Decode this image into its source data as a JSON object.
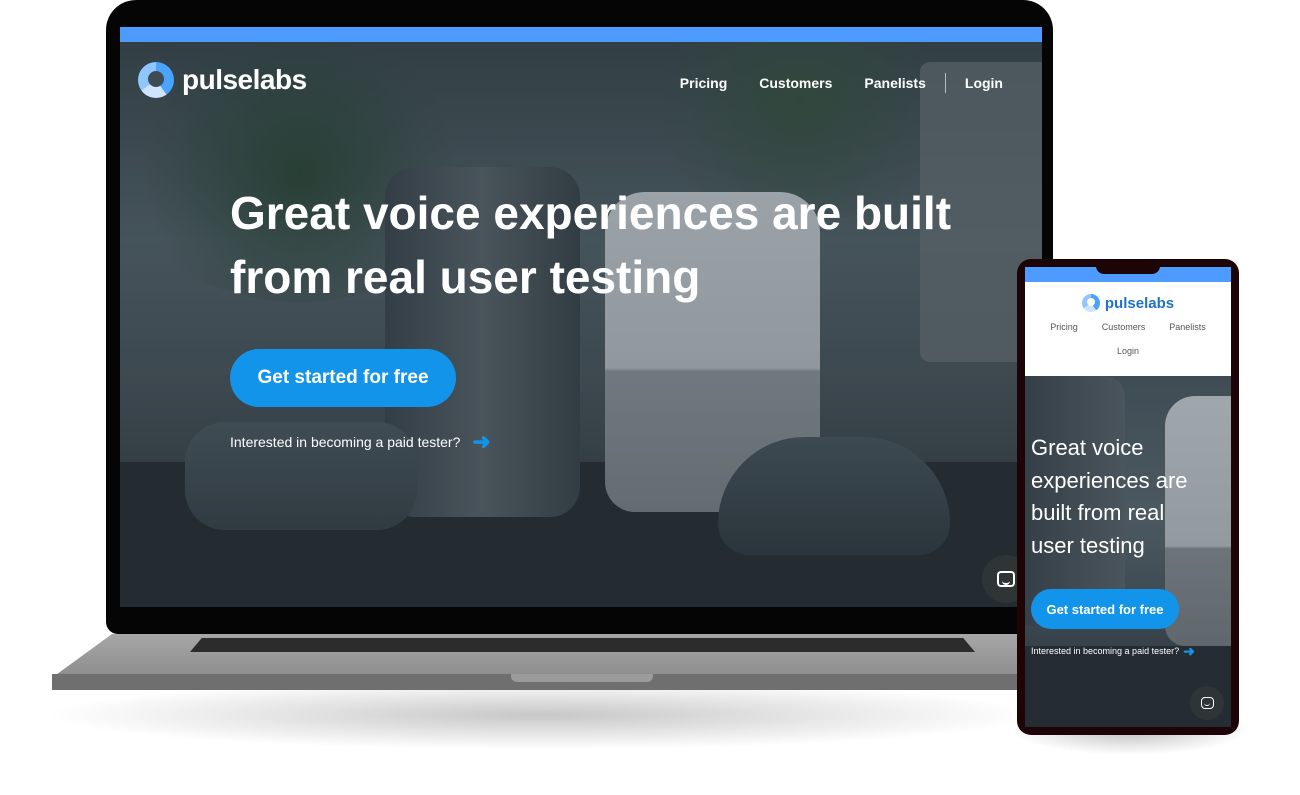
{
  "colors": {
    "accent_blue": "#1294ea",
    "top_strip": "#4d9bff",
    "phone_brand_text": "#1e73c7"
  },
  "brand": {
    "name": "pulselabs",
    "logo_icon": "pulse-labs-logo-icon"
  },
  "desktop": {
    "nav": {
      "pricing": "Pricing",
      "customers": "Customers",
      "panelists": "Panelists",
      "login": "Login"
    },
    "hero": {
      "title_line1": "Great voice experiences are built",
      "title_line2": "from real user testing",
      "cta_label": "Get started for free",
      "tester_link": "Interested in becoming a paid tester?",
      "arrow_icon": "arrow-right-icon"
    },
    "chat_icon": "chat-bubble-icon"
  },
  "mobile": {
    "nav": {
      "pricing": "Pricing",
      "customers": "Customers",
      "panelists": "Panelists",
      "login": "Login"
    },
    "hero": {
      "title_line1": "Great voice",
      "title_line2": "experiences are",
      "title_line3": "built from real",
      "title_line4": "user testing",
      "cta_label": "Get started for free",
      "tester_link": "Interested in becoming a paid tester?"
    },
    "chat_icon": "chat-bubble-icon"
  }
}
